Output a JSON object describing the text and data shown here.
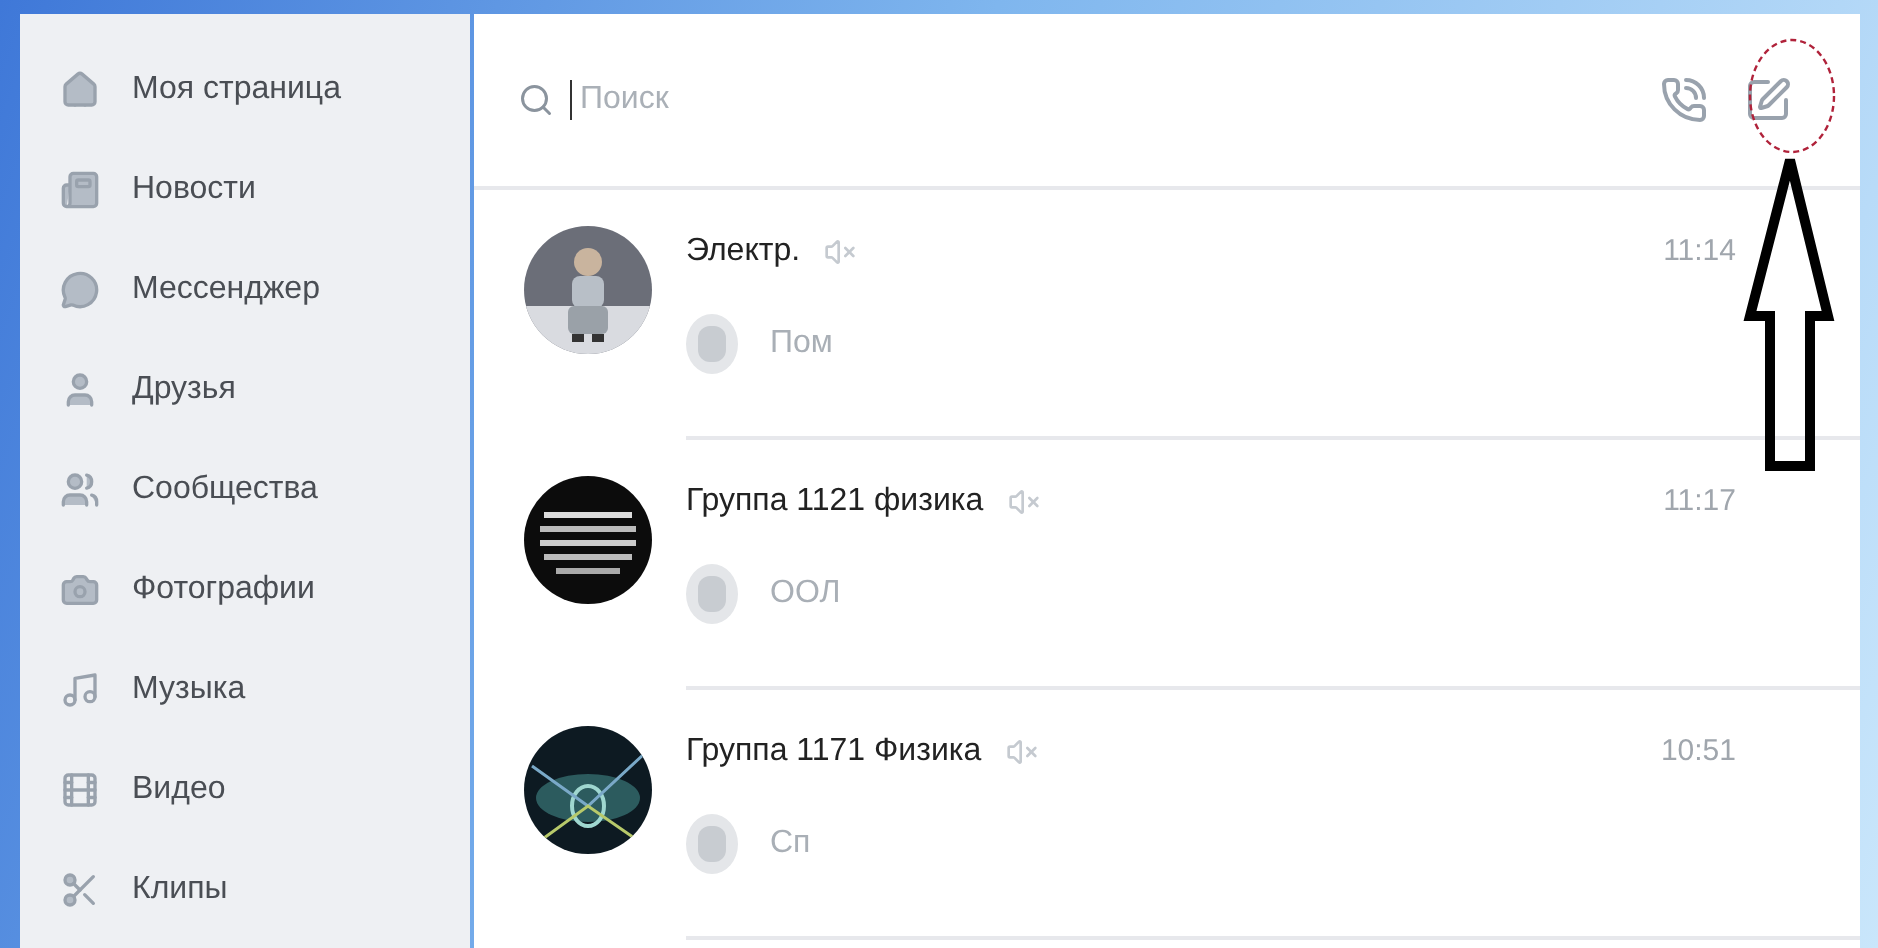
{
  "sidebar": {
    "items": [
      {
        "label": "Моя страница"
      },
      {
        "label": "Новости"
      },
      {
        "label": "Мессенджер"
      },
      {
        "label": "Друзья"
      },
      {
        "label": "Сообщества"
      },
      {
        "label": "Фотографии"
      },
      {
        "label": "Музыка"
      },
      {
        "label": "Видео"
      },
      {
        "label": "Клипы"
      }
    ]
  },
  "search": {
    "placeholder": "Поиск"
  },
  "chats": [
    {
      "name": "Электр.",
      "muted": true,
      "time": "11:14",
      "preview": "Пом"
    },
    {
      "name": "Группа 1121 физика",
      "muted": true,
      "time": "11:17",
      "preview": "ООЛ"
    },
    {
      "name": "Группа 1171 Физика",
      "muted": true,
      "time": "10:51",
      "preview": "Сп"
    }
  ]
}
